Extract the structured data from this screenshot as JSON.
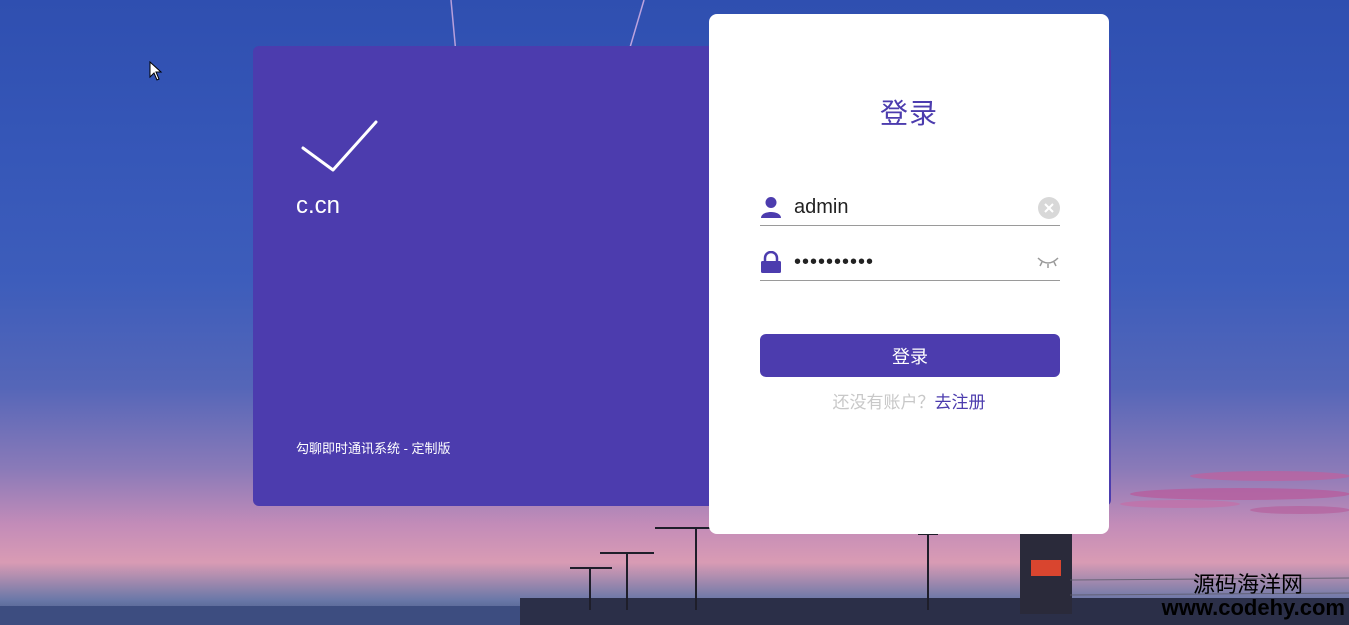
{
  "brand": {
    "name": "c.cn",
    "footer": "勾聊即时通讯系统 - 定制版"
  },
  "login": {
    "title": "登录",
    "username_value": "admin",
    "password_value": "••••••••••",
    "submit_label": "登录",
    "register_prompt": "还没有账户？",
    "register_link": "去注册"
  },
  "watermark": {
    "cn": "源码海洋网",
    "url": "www.codehy.com"
  },
  "icons": {
    "brand": "checkmark-icon",
    "username": "user-icon",
    "password": "lock-icon",
    "clear": "clear-icon",
    "toggle_password": "eye-closed-icon",
    "cursor": "mouse-pointer-icon"
  },
  "colors": {
    "accent": "#4c3cae",
    "card": "#ffffff",
    "muted_text": "#c8c8c8"
  }
}
